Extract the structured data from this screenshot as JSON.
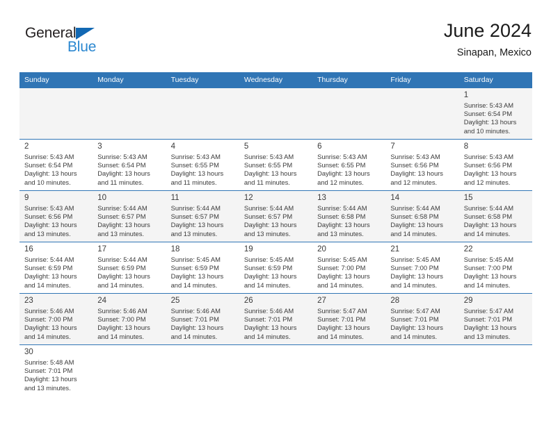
{
  "brand": {
    "name_primary": "General",
    "name_secondary": "Blue",
    "accent_color": "#2a87d0",
    "flag_color": "#1268b3"
  },
  "header": {
    "title": "June 2024",
    "subtitle": "Sinapan, Mexico"
  },
  "calendar": {
    "header_color": "#3075b5",
    "weekdays": [
      "Sunday",
      "Monday",
      "Tuesday",
      "Wednesday",
      "Thursday",
      "Friday",
      "Saturday"
    ],
    "weeks": [
      [
        {
          "day": "",
          "sunrise": "",
          "sunset": "",
          "daylight": "",
          "daylight2": ""
        },
        {
          "day": "",
          "sunrise": "",
          "sunset": "",
          "daylight": "",
          "daylight2": ""
        },
        {
          "day": "",
          "sunrise": "",
          "sunset": "",
          "daylight": "",
          "daylight2": ""
        },
        {
          "day": "",
          "sunrise": "",
          "sunset": "",
          "daylight": "",
          "daylight2": ""
        },
        {
          "day": "",
          "sunrise": "",
          "sunset": "",
          "daylight": "",
          "daylight2": ""
        },
        {
          "day": "",
          "sunrise": "",
          "sunset": "",
          "daylight": "",
          "daylight2": ""
        },
        {
          "day": "1",
          "sunrise": "Sunrise: 5:43 AM",
          "sunset": "Sunset: 6:54 PM",
          "daylight": "Daylight: 13 hours",
          "daylight2": "and 10 minutes."
        }
      ],
      [
        {
          "day": "2",
          "sunrise": "Sunrise: 5:43 AM",
          "sunset": "Sunset: 6:54 PM",
          "daylight": "Daylight: 13 hours",
          "daylight2": "and 10 minutes."
        },
        {
          "day": "3",
          "sunrise": "Sunrise: 5:43 AM",
          "sunset": "Sunset: 6:54 PM",
          "daylight": "Daylight: 13 hours",
          "daylight2": "and 11 minutes."
        },
        {
          "day": "4",
          "sunrise": "Sunrise: 5:43 AM",
          "sunset": "Sunset: 6:55 PM",
          "daylight": "Daylight: 13 hours",
          "daylight2": "and 11 minutes."
        },
        {
          "day": "5",
          "sunrise": "Sunrise: 5:43 AM",
          "sunset": "Sunset: 6:55 PM",
          "daylight": "Daylight: 13 hours",
          "daylight2": "and 11 minutes."
        },
        {
          "day": "6",
          "sunrise": "Sunrise: 5:43 AM",
          "sunset": "Sunset: 6:55 PM",
          "daylight": "Daylight: 13 hours",
          "daylight2": "and 12 minutes."
        },
        {
          "day": "7",
          "sunrise": "Sunrise: 5:43 AM",
          "sunset": "Sunset: 6:56 PM",
          "daylight": "Daylight: 13 hours",
          "daylight2": "and 12 minutes."
        },
        {
          "day": "8",
          "sunrise": "Sunrise: 5:43 AM",
          "sunset": "Sunset: 6:56 PM",
          "daylight": "Daylight: 13 hours",
          "daylight2": "and 12 minutes."
        }
      ],
      [
        {
          "day": "9",
          "sunrise": "Sunrise: 5:43 AM",
          "sunset": "Sunset: 6:56 PM",
          "daylight": "Daylight: 13 hours",
          "daylight2": "and 13 minutes."
        },
        {
          "day": "10",
          "sunrise": "Sunrise: 5:44 AM",
          "sunset": "Sunset: 6:57 PM",
          "daylight": "Daylight: 13 hours",
          "daylight2": "and 13 minutes."
        },
        {
          "day": "11",
          "sunrise": "Sunrise: 5:44 AM",
          "sunset": "Sunset: 6:57 PM",
          "daylight": "Daylight: 13 hours",
          "daylight2": "and 13 minutes."
        },
        {
          "day": "12",
          "sunrise": "Sunrise: 5:44 AM",
          "sunset": "Sunset: 6:57 PM",
          "daylight": "Daylight: 13 hours",
          "daylight2": "and 13 minutes."
        },
        {
          "day": "13",
          "sunrise": "Sunrise: 5:44 AM",
          "sunset": "Sunset: 6:58 PM",
          "daylight": "Daylight: 13 hours",
          "daylight2": "and 13 minutes."
        },
        {
          "day": "14",
          "sunrise": "Sunrise: 5:44 AM",
          "sunset": "Sunset: 6:58 PM",
          "daylight": "Daylight: 13 hours",
          "daylight2": "and 14 minutes."
        },
        {
          "day": "15",
          "sunrise": "Sunrise: 5:44 AM",
          "sunset": "Sunset: 6:58 PM",
          "daylight": "Daylight: 13 hours",
          "daylight2": "and 14 minutes."
        }
      ],
      [
        {
          "day": "16",
          "sunrise": "Sunrise: 5:44 AM",
          "sunset": "Sunset: 6:59 PM",
          "daylight": "Daylight: 13 hours",
          "daylight2": "and 14 minutes."
        },
        {
          "day": "17",
          "sunrise": "Sunrise: 5:44 AM",
          "sunset": "Sunset: 6:59 PM",
          "daylight": "Daylight: 13 hours",
          "daylight2": "and 14 minutes."
        },
        {
          "day": "18",
          "sunrise": "Sunrise: 5:45 AM",
          "sunset": "Sunset: 6:59 PM",
          "daylight": "Daylight: 13 hours",
          "daylight2": "and 14 minutes."
        },
        {
          "day": "19",
          "sunrise": "Sunrise: 5:45 AM",
          "sunset": "Sunset: 6:59 PM",
          "daylight": "Daylight: 13 hours",
          "daylight2": "and 14 minutes."
        },
        {
          "day": "20",
          "sunrise": "Sunrise: 5:45 AM",
          "sunset": "Sunset: 7:00 PM",
          "daylight": "Daylight: 13 hours",
          "daylight2": "and 14 minutes."
        },
        {
          "day": "21",
          "sunrise": "Sunrise: 5:45 AM",
          "sunset": "Sunset: 7:00 PM",
          "daylight": "Daylight: 13 hours",
          "daylight2": "and 14 minutes."
        },
        {
          "day": "22",
          "sunrise": "Sunrise: 5:45 AM",
          "sunset": "Sunset: 7:00 PM",
          "daylight": "Daylight: 13 hours",
          "daylight2": "and 14 minutes."
        }
      ],
      [
        {
          "day": "23",
          "sunrise": "Sunrise: 5:46 AM",
          "sunset": "Sunset: 7:00 PM",
          "daylight": "Daylight: 13 hours",
          "daylight2": "and 14 minutes."
        },
        {
          "day": "24",
          "sunrise": "Sunrise: 5:46 AM",
          "sunset": "Sunset: 7:00 PM",
          "daylight": "Daylight: 13 hours",
          "daylight2": "and 14 minutes."
        },
        {
          "day": "25",
          "sunrise": "Sunrise: 5:46 AM",
          "sunset": "Sunset: 7:01 PM",
          "daylight": "Daylight: 13 hours",
          "daylight2": "and 14 minutes."
        },
        {
          "day": "26",
          "sunrise": "Sunrise: 5:46 AM",
          "sunset": "Sunset: 7:01 PM",
          "daylight": "Daylight: 13 hours",
          "daylight2": "and 14 minutes."
        },
        {
          "day": "27",
          "sunrise": "Sunrise: 5:47 AM",
          "sunset": "Sunset: 7:01 PM",
          "daylight": "Daylight: 13 hours",
          "daylight2": "and 14 minutes."
        },
        {
          "day": "28",
          "sunrise": "Sunrise: 5:47 AM",
          "sunset": "Sunset: 7:01 PM",
          "daylight": "Daylight: 13 hours",
          "daylight2": "and 14 minutes."
        },
        {
          "day": "29",
          "sunrise": "Sunrise: 5:47 AM",
          "sunset": "Sunset: 7:01 PM",
          "daylight": "Daylight: 13 hours",
          "daylight2": "and 13 minutes."
        }
      ],
      [
        {
          "day": "30",
          "sunrise": "Sunrise: 5:48 AM",
          "sunset": "Sunset: 7:01 PM",
          "daylight": "Daylight: 13 hours",
          "daylight2": "and 13 minutes."
        },
        {
          "day": "",
          "sunrise": "",
          "sunset": "",
          "daylight": "",
          "daylight2": ""
        },
        {
          "day": "",
          "sunrise": "",
          "sunset": "",
          "daylight": "",
          "daylight2": ""
        },
        {
          "day": "",
          "sunrise": "",
          "sunset": "",
          "daylight": "",
          "daylight2": ""
        },
        {
          "day": "",
          "sunrise": "",
          "sunset": "",
          "daylight": "",
          "daylight2": ""
        },
        {
          "day": "",
          "sunrise": "",
          "sunset": "",
          "daylight": "",
          "daylight2": ""
        },
        {
          "day": "",
          "sunrise": "",
          "sunset": "",
          "daylight": "",
          "daylight2": ""
        }
      ]
    ]
  }
}
